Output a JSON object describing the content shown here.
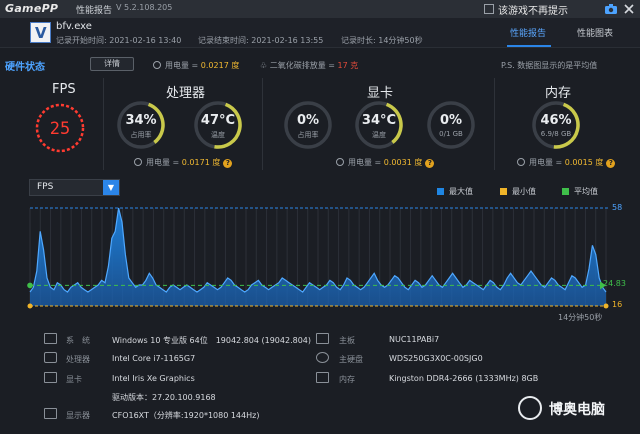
{
  "titlebar": {
    "logo": "GamePP",
    "title": "性能报告",
    "version": "V 5.2.108.205",
    "notice": "该游戏不再提示"
  },
  "header": {
    "app_name": "bfv.exe",
    "record_start_label": "记录开始时间:",
    "record_start": "2021-02-16 13:40",
    "record_end_label": "记录结束时间:",
    "record_end": "2021-02-16 13:55",
    "duration_label": "记录时长:",
    "duration": "14分钟50秒",
    "tabs": [
      {
        "label": "性能报告",
        "active": true
      },
      {
        "label": "性能图表",
        "active": false
      }
    ]
  },
  "status": {
    "title": "硬件状态",
    "detail_button": "详情",
    "power_label": "用电量 =",
    "power_value": "0.0217 度",
    "co2_label": "二氧化碳排放量 =",
    "co2_value": "17 克",
    "note": "P.S. 数据图显示的是平均值"
  },
  "fps": {
    "label": "FPS",
    "value": "25"
  },
  "cpu": {
    "label": "处理器",
    "usage_value": "34%",
    "usage_label": "占用率",
    "usage_fraction": 0.34,
    "temp_value": "47°C",
    "temp_label": "温度",
    "temp_fraction": 0.47,
    "power_label": "用电量 =",
    "power_value": "0.0171 度"
  },
  "gpu": {
    "label": "显卡",
    "usage_value": "0%",
    "usage_label": "占用率",
    "usage_fraction": 0.0,
    "temp_value": "34°C",
    "temp_label": "温度",
    "temp_fraction": 0.34,
    "vram_value": "0%",
    "vram_label": "0/1 GB",
    "vram_fraction": 0.0,
    "power_label": "用电量 =",
    "power_value": "0.0031 度"
  },
  "memory": {
    "label": "内存",
    "usage_value": "46%",
    "usage_label": "6.9/8 GB",
    "usage_fraction": 0.46,
    "power_label": "用电量 =",
    "power_value": "0.0015 度"
  },
  "chart_select": "FPS",
  "legend": [
    {
      "name": "最大值",
      "color": "#1f86e3"
    },
    {
      "name": "最小值",
      "color": "#f0b429"
    },
    {
      "name": "平均值",
      "color": "#3fbf4a"
    }
  ],
  "chart_data": {
    "type": "area",
    "ylim": [
      16,
      58
    ],
    "labels": {
      "max": "58",
      "avg": "24.83",
      "min": "16"
    },
    "x_end_label": "14分钟50秒",
    "series": [
      {
        "name": "最大值",
        "color": "#1f86e3",
        "values": [
          22,
          24,
          31,
          48,
          40,
          28,
          24,
          23,
          26,
          25,
          23,
          22,
          24,
          25,
          26,
          24,
          23,
          22,
          23,
          24,
          25,
          27,
          26,
          33,
          45,
          48,
          58,
          52,
          38,
          28,
          26,
          24,
          25,
          25,
          27,
          30,
          28,
          25,
          24,
          23,
          22,
          24,
          25,
          24,
          23,
          24,
          25,
          24,
          23,
          22,
          23,
          24,
          26,
          25,
          24,
          23,
          24,
          26,
          28,
          27,
          25,
          24,
          23,
          22,
          23,
          25,
          26,
          27,
          25,
          24,
          23,
          24,
          25,
          26,
          28,
          27,
          26,
          25,
          24,
          23,
          22,
          24,
          26,
          25,
          24,
          23,
          24,
          25,
          27,
          26,
          24,
          23,
          25,
          28,
          27,
          25,
          24,
          23,
          24,
          26,
          28,
          30,
          27,
          25,
          24,
          25,
          27,
          29,
          28,
          26,
          24,
          23,
          25,
          27,
          26,
          24,
          25,
          27,
          29,
          27,
          25,
          24,
          26,
          28,
          30,
          28,
          26,
          24,
          25,
          27,
          26,
          25,
          24,
          23,
          25,
          27,
          26,
          24,
          23,
          25,
          28,
          30,
          28,
          26,
          25,
          27,
          29,
          31,
          29,
          27,
          25,
          24,
          26,
          28,
          27,
          25,
          24,
          23,
          26,
          29,
          28,
          26,
          24,
          25,
          32,
          42,
          38,
          28,
          24,
          22
        ]
      }
    ],
    "avg_value": 24.83
  },
  "sysinfo": {
    "system_label": "系　统",
    "system": "Windows 10 专业版 64位　19042.804 (19042.804)",
    "cpu_label": "处理器",
    "cpu": "Intel Core i7-1165G7",
    "gpu_label": "显卡",
    "gpu": "Intel Iris Xe Graphics",
    "driver_label": "驱动版本：",
    "driver": "27.20.100.9168",
    "display_label": "显示器",
    "display": "CFO16XT（分辨率:1920*1080 144Hz)",
    "board_label": "主板",
    "board": "NUC11PABi7",
    "disk_label": "主硬盘",
    "disk": "WDS250G3X0C-00SJG0",
    "ram_label": "内存",
    "ram": "Kingston DDR4-2666 (1333MHz) 8GB"
  },
  "watermark": "博奥电脑"
}
